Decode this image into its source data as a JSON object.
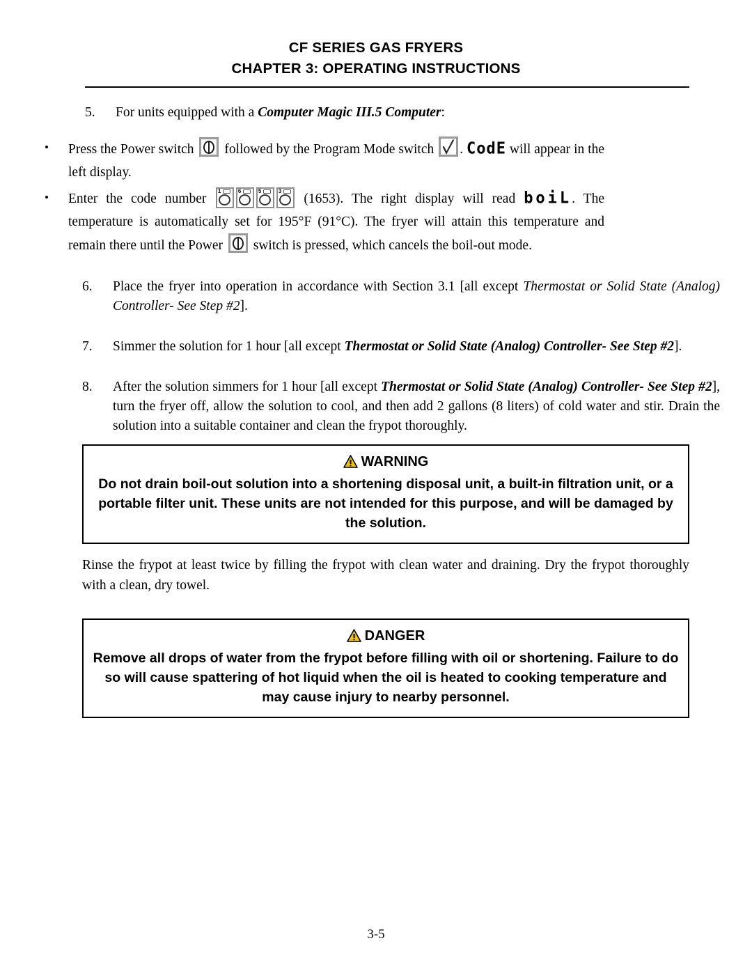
{
  "document": {
    "header_line1": "CF SERIES GAS FRYERS",
    "header_line2_prefix": "CHAPTER",
    "header_line2_rest": "3:  OPERATING INSTRUCTIONS",
    "page_number": "3-5"
  },
  "step5": {
    "number": "5.",
    "lead_before": "For units equipped with a ",
    "lead_italic": "Computer Magic III.5 Computer",
    "lead_after": ":",
    "bullets": [
      {
        "bullet_char": "•",
        "seg1": "Press the Power switch ",
        "icon1": "power-switch-icon",
        "seg2": " followed by the Program Mode switch ",
        "icon2": "program-mode-check-icon",
        "seg3": ". ",
        "display_word": "CodE",
        "seg4": " will appear in the left display."
      },
      {
        "bullet_char": "•",
        "seg1": "Enter the code number ",
        "code_buttons": [
          "1",
          "6",
          "5",
          "3"
        ],
        "seg2": " (1653).  The right display will read ",
        "display_word": "boiL",
        "seg3": ".  The temperature is automatically set for 195°F (91°C).  The fryer will attain this temperature and remain there until the Power ",
        "icon1": "power-switch-icon",
        "seg4": " switch is pressed, which cancels the boil-out mode."
      }
    ]
  },
  "step6": {
    "number": "6.",
    "text_before": "Place the fryer into operation in accordance with Section 3.1 [all except ",
    "italic": "Thermostat or Solid State (Analog) Controller- See Step #2",
    "text_after": "]."
  },
  "step7": {
    "number": "7.",
    "text_before": "Simmer the solution for 1 hour [all except ",
    "bold_italic": "Thermostat or Solid State (Analog) Controller- See Step #2",
    "text_after": "]."
  },
  "step8": {
    "number": "8.",
    "text_before": "After the solution simmers for 1 hour [all except ",
    "bold_italic": "Thermostat or Solid State (Analog) Controller- See Step #2",
    "text_after": "], turn the fryer off, allow the solution to cool, and then add 2 gallons (8 liters) of cold water and stir.  Drain the solution into a suitable container and clean the frypot thoroughly."
  },
  "warning_box": {
    "icon": "warning-triangle-icon",
    "heading": "WARNING",
    "body": "Do not drain boil-out solution into a shortening disposal unit, a built-in filtration unit, or a portable filter unit.  These units are not intended for this purpose, and will be damaged by the solution.",
    "icon_fill": "#F2C200",
    "icon_stroke": "#000000"
  },
  "rinse_paragraph": {
    "text": "Rinse the frypot at least twice by filling the frypot with clean water and draining.  Dry the frypot thoroughly with a clean, dry towel."
  },
  "danger_box": {
    "icon": "danger-triangle-icon",
    "heading": "DANGER",
    "body": "Remove all drops of water from the frypot before filling with oil or shortening.  Failure to do so will cause spattering of hot liquid when the oil is heated to cooking temperature and may cause injury to nearby personnel.",
    "icon_fill": "#F2C200",
    "icon_stroke": "#000000"
  }
}
